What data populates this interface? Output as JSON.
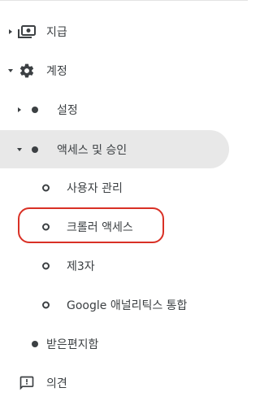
{
  "nav": {
    "payments": {
      "label": "지급",
      "icon": "money-icon",
      "expanded": false
    },
    "account": {
      "label": "계정",
      "icon": "gear-icon",
      "expanded": true
    },
    "settings": {
      "label": "설정",
      "expanded": false
    },
    "access": {
      "label": "액세스 및 승인",
      "expanded": true,
      "selected": true
    },
    "user_management": {
      "label": "사용자 관리"
    },
    "crawler_access": {
      "label": "크롤러 액세스",
      "highlighted": true
    },
    "third_party": {
      "label": "제3자"
    },
    "google_analytics": {
      "label": "Google 애널리틱스 통합"
    },
    "inbox": {
      "label": "받은편지함"
    },
    "feedback": {
      "label": "의견",
      "icon": "feedback-icon"
    }
  },
  "colors": {
    "selected_bg": "#e8e8e8",
    "highlight_border": "#d93025",
    "text": "#3c4043"
  }
}
